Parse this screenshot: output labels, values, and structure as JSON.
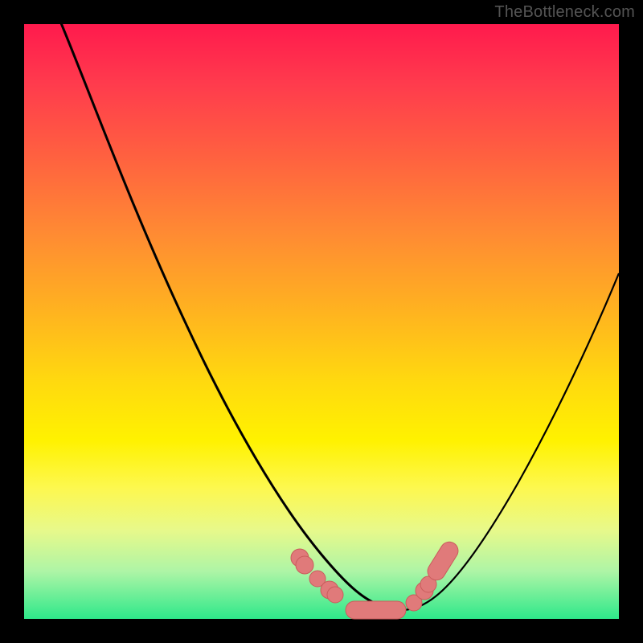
{
  "watermark": "TheBottleneck.com",
  "colors": {
    "frame": "#000000",
    "watermark_text": "#545454",
    "gradient_top": "#ff1a4d",
    "gradient_mid": "#fff200",
    "gradient_bottom": "#2ee88a",
    "curve_stroke": "#000000",
    "marker_fill": "#e07a7a",
    "marker_stroke": "#c95c5c"
  },
  "chart_data": {
    "type": "line",
    "title": "",
    "xlabel": "",
    "ylabel": "",
    "xlim": [
      0,
      100
    ],
    "ylim": [
      0,
      100
    ],
    "grid": false,
    "legend": false,
    "note": "No axis ticks or numeric labels are visible; values are pixel-estimated positions on a 0–100 normalized canvas",
    "series": [
      {
        "name": "left-descending-curve",
        "x": [
          6,
          12,
          18,
          24,
          30,
          36,
          42,
          48,
          52,
          55,
          58,
          60,
          62,
          64
        ],
        "y": [
          100,
          88,
          76,
          64,
          52,
          41,
          31,
          21,
          14,
          9,
          6,
          4,
          3,
          2
        ]
      },
      {
        "name": "right-ascending-curve",
        "x": [
          64,
          66,
          68,
          71,
          74,
          78,
          82,
          86,
          90,
          94,
          98,
          100
        ],
        "y": [
          2,
          3,
          5,
          8,
          13,
          20,
          28,
          36,
          44,
          52,
          60,
          63
        ]
      }
    ],
    "markers": [
      {
        "name": "left-cluster-1",
        "x": 47,
        "y": 10,
        "r": 2.2
      },
      {
        "name": "left-cluster-2",
        "x": 49,
        "y": 8,
        "r": 2.0
      },
      {
        "name": "left-cluster-3",
        "x": 51,
        "y": 6,
        "r": 2.2
      },
      {
        "name": "trough-pill",
        "shape": "pill",
        "x1": 54,
        "x2": 63,
        "y": 2.5,
        "r": 2.3
      },
      {
        "name": "right-cluster-1",
        "x": 65,
        "y": 5,
        "r": 2.0
      },
      {
        "name": "right-cluster-2",
        "x": 67,
        "y": 8,
        "r": 2.2
      },
      {
        "name": "right-pill",
        "shape": "pill",
        "x1": 68,
        "x2": 71,
        "y1": 10,
        "y2": 14,
        "r": 2.3
      }
    ]
  }
}
